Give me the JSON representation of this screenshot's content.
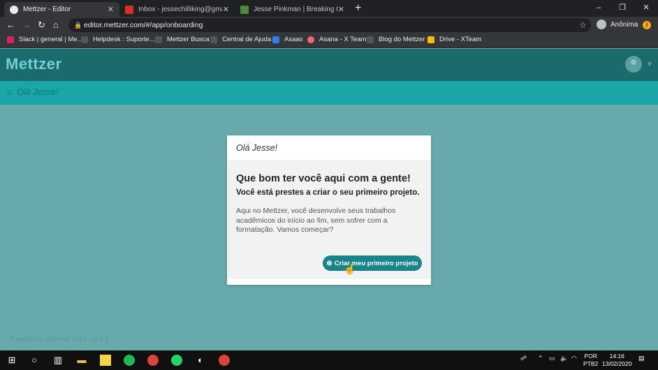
{
  "browser": {
    "tabs": [
      {
        "title": "Mettzer - Editor",
        "active": true,
        "favicon_color": "#e8eaed"
      },
      {
        "title": "Inbox - jessechilliking@gmail.com",
        "active": false,
        "favicon_color": "#d93025"
      },
      {
        "title": "Jesse Pinkman | Breaking Bad Wiki",
        "active": false,
        "favicon_color": "#4d8a3d"
      }
    ],
    "new_tab": "+",
    "window_controls": [
      "–",
      "❐",
      "✕"
    ],
    "url": "editor.mettzer.com/#/app/onboarding",
    "profile_label": "Anônima",
    "alert_icon": "!",
    "bookmarks": [
      {
        "label": "Slack | general | Me...",
        "color": "#e01e5a"
      },
      {
        "label": "Helpdesk : Suporte...",
        "color": "#555555"
      },
      {
        "label": "Mettzer Busca",
        "color": "#555555"
      },
      {
        "label": "Central de Ajuda",
        "color": "#555555"
      },
      {
        "label": "Asaas",
        "color": "#2f80ed"
      },
      {
        "label": "Asana - X Team",
        "color": "#f06a6a"
      },
      {
        "label": "Blog do Mettzer",
        "color": "#555555"
      },
      {
        "label": "Drive - XTeam",
        "color": "#fbbc04"
      }
    ]
  },
  "app": {
    "logo": "Mettzer",
    "greeting": "Olá Jesse!",
    "footer": "Powered by ©Mettzer 2019 - v3.8.5"
  },
  "card": {
    "header": "Olá Jesse!",
    "title": "Que bom ter você aqui com a gente!",
    "subtitle": "Você está prestes a criar o seu primeiro projeto.",
    "text": "Aqui no Mettzer, você desenvolve seus trabalhos acadêmicos do início ao fim, sem sofrer com a formatação. Vamos começar?",
    "cta_label": "Criar meu primeiro projeto"
  },
  "taskbar": {
    "language": "POR",
    "layout": "PTB2",
    "time": "14:16",
    "date": "13/02/2020"
  }
}
